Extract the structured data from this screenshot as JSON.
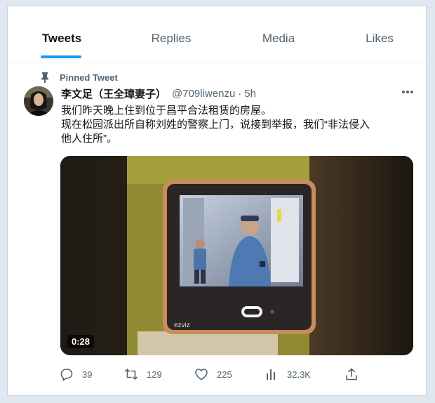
{
  "tabs": [
    {
      "label": "Tweets"
    },
    {
      "label": "Replies"
    },
    {
      "label": "Media"
    },
    {
      "label": "Likes"
    }
  ],
  "active_tab": "Tweets",
  "pinned_label": "Pinned Tweet",
  "tweet": {
    "display_name": "李文足（王全璋妻子）",
    "handle": "@709liwenzu",
    "separator": "·",
    "time": "5h",
    "text_lines": [
      "我们昨天晚上住到位于昌平合法租赁的房屋。",
      "现在松园派出所自称刘姓的警察上门，说接到举报，我们“非法侵入",
      "他人住所”。"
    ],
    "media": {
      "duration": "0:28",
      "device_brand": "ezviz"
    }
  },
  "actions": {
    "replies": "39",
    "retweets": "129",
    "likes": "225",
    "views": "32.3K"
  },
  "icons": [
    "pin-icon",
    "more-icon",
    "reply-icon",
    "retweet-icon",
    "like-icon",
    "views-icon",
    "share-icon"
  ],
  "colors": {
    "accent": "#1d9bf0",
    "muted": "#536471",
    "text": "#0f1419"
  }
}
